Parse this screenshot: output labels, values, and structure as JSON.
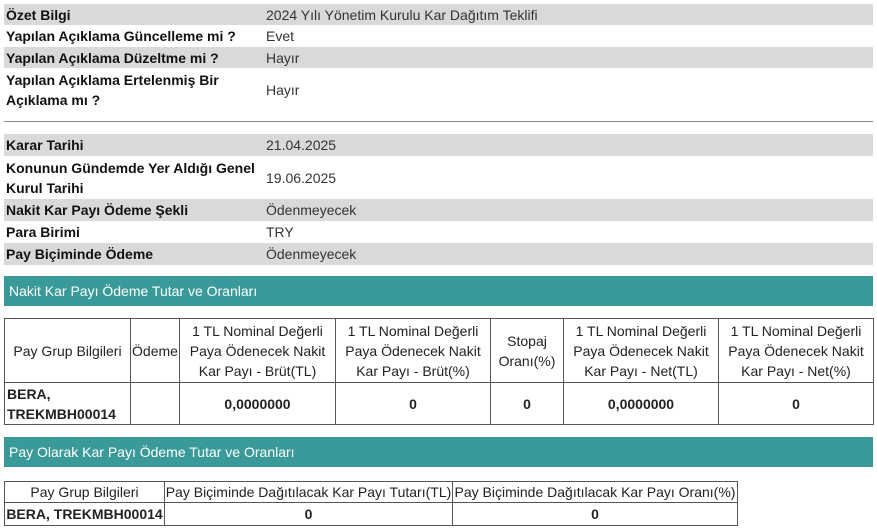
{
  "summary": {
    "rows": [
      {
        "label": "Özet Bilgi",
        "value": "2024 Yılı Yönetim Kurulu Kar Dağıtım Teklifi"
      },
      {
        "label": "Yapılan Açıklama Güncelleme mi ?",
        "value": "Evet"
      },
      {
        "label": "Yapılan Açıklama Düzeltme mi ?",
        "value": "Hayır"
      },
      {
        "label": "Yapılan Açıklama Ertelenmiş Bir Açıklama mı ?",
        "value": "Hayır"
      }
    ]
  },
  "details": {
    "rows": [
      {
        "label": "Karar Tarihi",
        "value": "21.04.2025"
      },
      {
        "label": "Konunun Gündemde Yer Aldığı Genel Kurul Tarihi",
        "value": "19.06.2025"
      },
      {
        "label": "Nakit Kar Payı Ödeme Şekli",
        "value": "Ödenmeyecek"
      },
      {
        "label": "Para Birimi",
        "value": "TRY"
      },
      {
        "label": "Pay Biçiminde Ödeme",
        "value": "Ödenmeyecek"
      }
    ]
  },
  "cash_section": {
    "title": "Nakit Kar Payı Ödeme Tutar ve Oranları",
    "headers": [
      "Pay Grup Bilgileri",
      "Ödeme",
      "1 TL Nominal Değerli Paya Ödenecek Nakit Kar Payı - Brüt(TL)",
      "1 TL Nominal Değerli Paya Ödenecek Nakit Kar Payı - Brüt(%)",
      "Stopaj Oranı(%)",
      "1 TL Nominal Değerli Paya Ödenecek Nakit Kar Payı - Net(TL)",
      "1 TL Nominal Değerli Paya Ödenecek Nakit Kar Payı - Net(%)"
    ],
    "row": [
      "BERA, TREKMBH00014",
      "",
      "0,0000000",
      "0",
      "0",
      "0,0000000",
      "0"
    ]
  },
  "share_section": {
    "title": "Pay Olarak Kar Payı Ödeme Tutar ve Oranları",
    "headers": [
      "Pay Grup Bilgileri",
      "Pay Biçiminde Dağıtılacak Kar Payı Tutarı(TL)",
      "Pay Biçiminde Dağıtılacak Kar Payı Oranı(%)"
    ],
    "row": [
      "BERA, TREKMBH00014",
      "0",
      "0"
    ]
  }
}
